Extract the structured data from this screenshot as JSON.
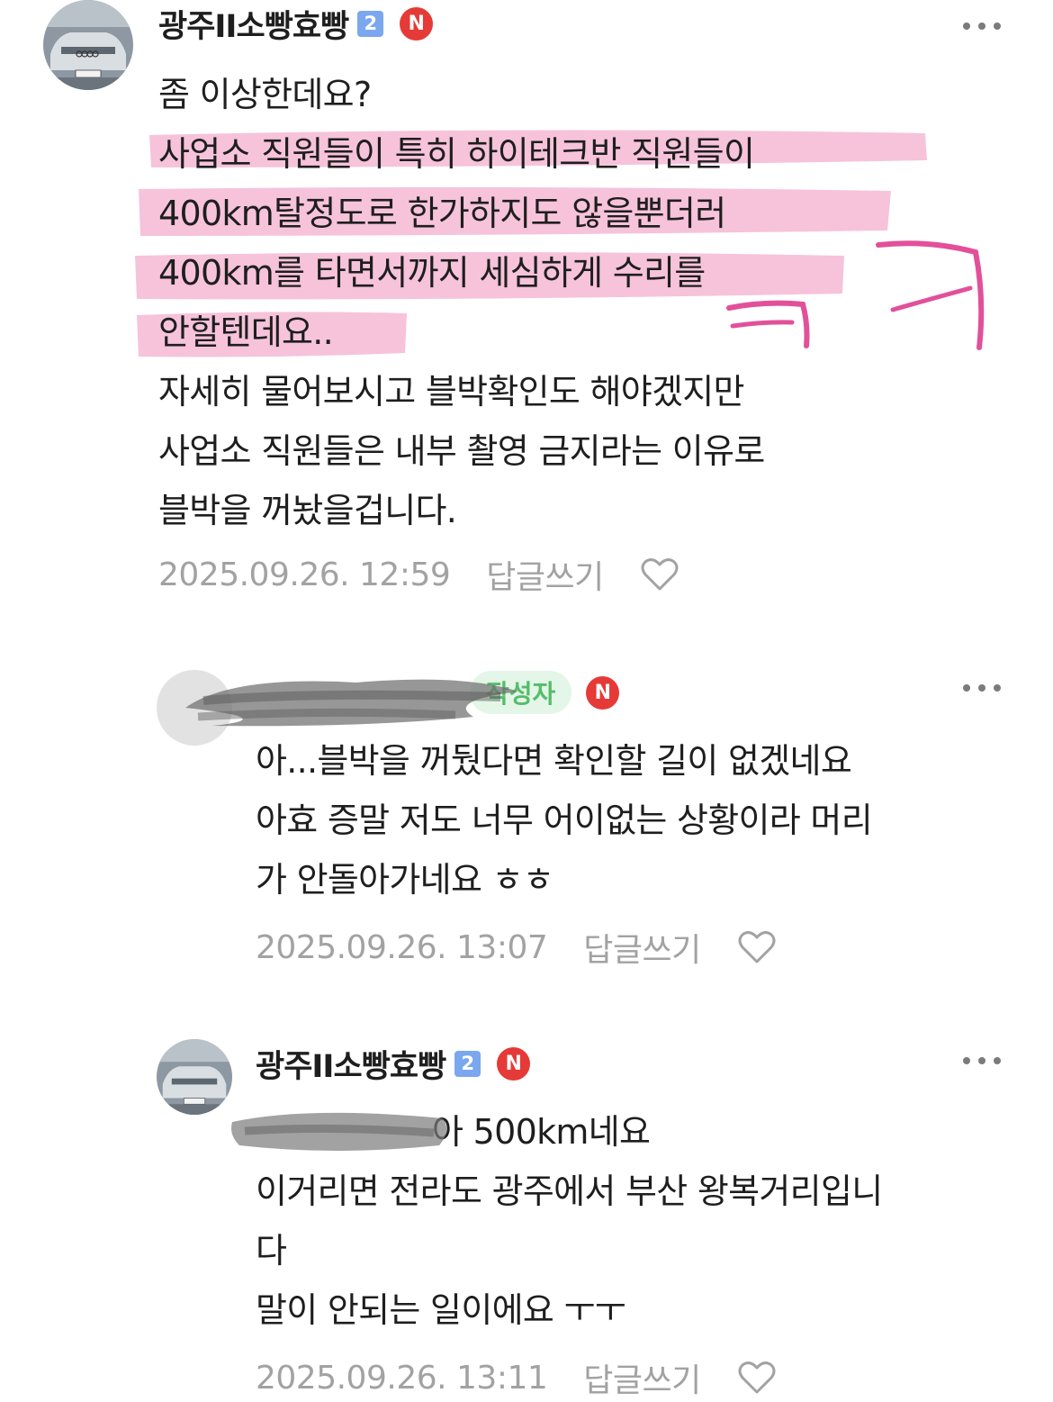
{
  "comments": [
    {
      "author": "광주II소빵효빵",
      "level": "2",
      "new_badge": "N",
      "lines": [
        "좀 이상한데요?",
        "사업소 직원들이 특히 하이테크반 직원들이",
        "400km탈정도로 한가하지도 않을뿐더러",
        "400km를 타면서까지 세심하게 수리를",
        "안할텐데요..",
        "자세히 물어보시고 블박확인도 해야겠지만",
        "사업소 직원들은 내부 촬영 금지라는 이유로",
        "블박을 꺼놨을겁니다."
      ],
      "highlighted_lines": [
        1,
        2,
        3,
        4
      ],
      "handwritten_annotation": "ㅋㅋ",
      "highlight_color": "#f5b9d3",
      "annotation_color": "#e2509a",
      "timestamp": "2025.09.26. 12:59",
      "reply_label": "답글쓰기"
    },
    {
      "author_redacted": true,
      "writer_tag": "작성자",
      "new_badge": "N",
      "lines": [
        "아...블박을 꺼뒀다면 확인할 길이 없겠네요",
        "아효 증말 저도 너무 어이없는 상황이라 머리",
        "가 안돌아가네요 ㅎㅎ"
      ],
      "timestamp": "2025.09.26. 13:07",
      "reply_label": "답글쓰기"
    },
    {
      "author": "광주II소빵효빵",
      "level": "2",
      "new_badge": "N",
      "first_line_visible": "아 500km네요",
      "lines": [
        "이거리면 전라도 광주에서 부산 왕복거리입니",
        "다",
        "말이 안되는 일이에요 ㅜㅜ"
      ],
      "timestamp": "2025.09.26. 13:11",
      "reply_label": "답글쓰기"
    }
  ],
  "colors": {
    "text": "#1e1e1e",
    "meta": "#a2a2a2",
    "level_badge": "#7aa7ee",
    "new_badge": "#e53a37",
    "writer_tag_bg": "#e3f6e7",
    "writer_tag_text": "#55bd6a"
  },
  "icons": [
    "more-icon",
    "heart-icon",
    "level-badge-icon",
    "new-badge-icon"
  ]
}
